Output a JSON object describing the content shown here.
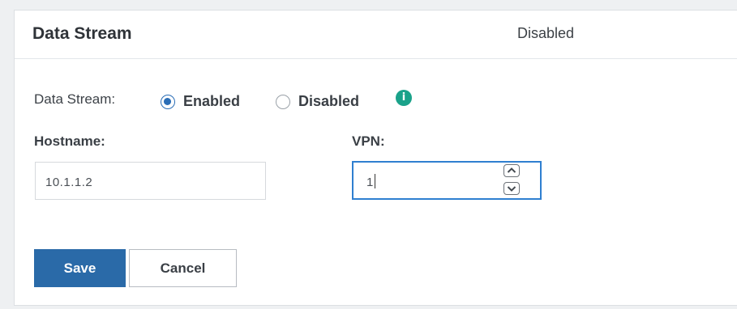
{
  "header": {
    "title": "Data Stream",
    "status": "Disabled"
  },
  "form": {
    "data_stream_label": "Data Stream:",
    "options": [
      {
        "label": "Enabled",
        "selected": true
      },
      {
        "label": "Disabled",
        "selected": false
      }
    ],
    "info_icon": "info-icon",
    "hostname_label": "Hostname:",
    "hostname_value": "10.1.1.2",
    "vpn_label": "VPN:",
    "vpn_value": "1"
  },
  "buttons": {
    "save": "Save",
    "cancel": "Cancel"
  },
  "colors": {
    "primary": "#2a6aa8",
    "radio_selected": "#2a6db6",
    "info": "#1aa28a",
    "focus_border": "#2f7fd0"
  }
}
